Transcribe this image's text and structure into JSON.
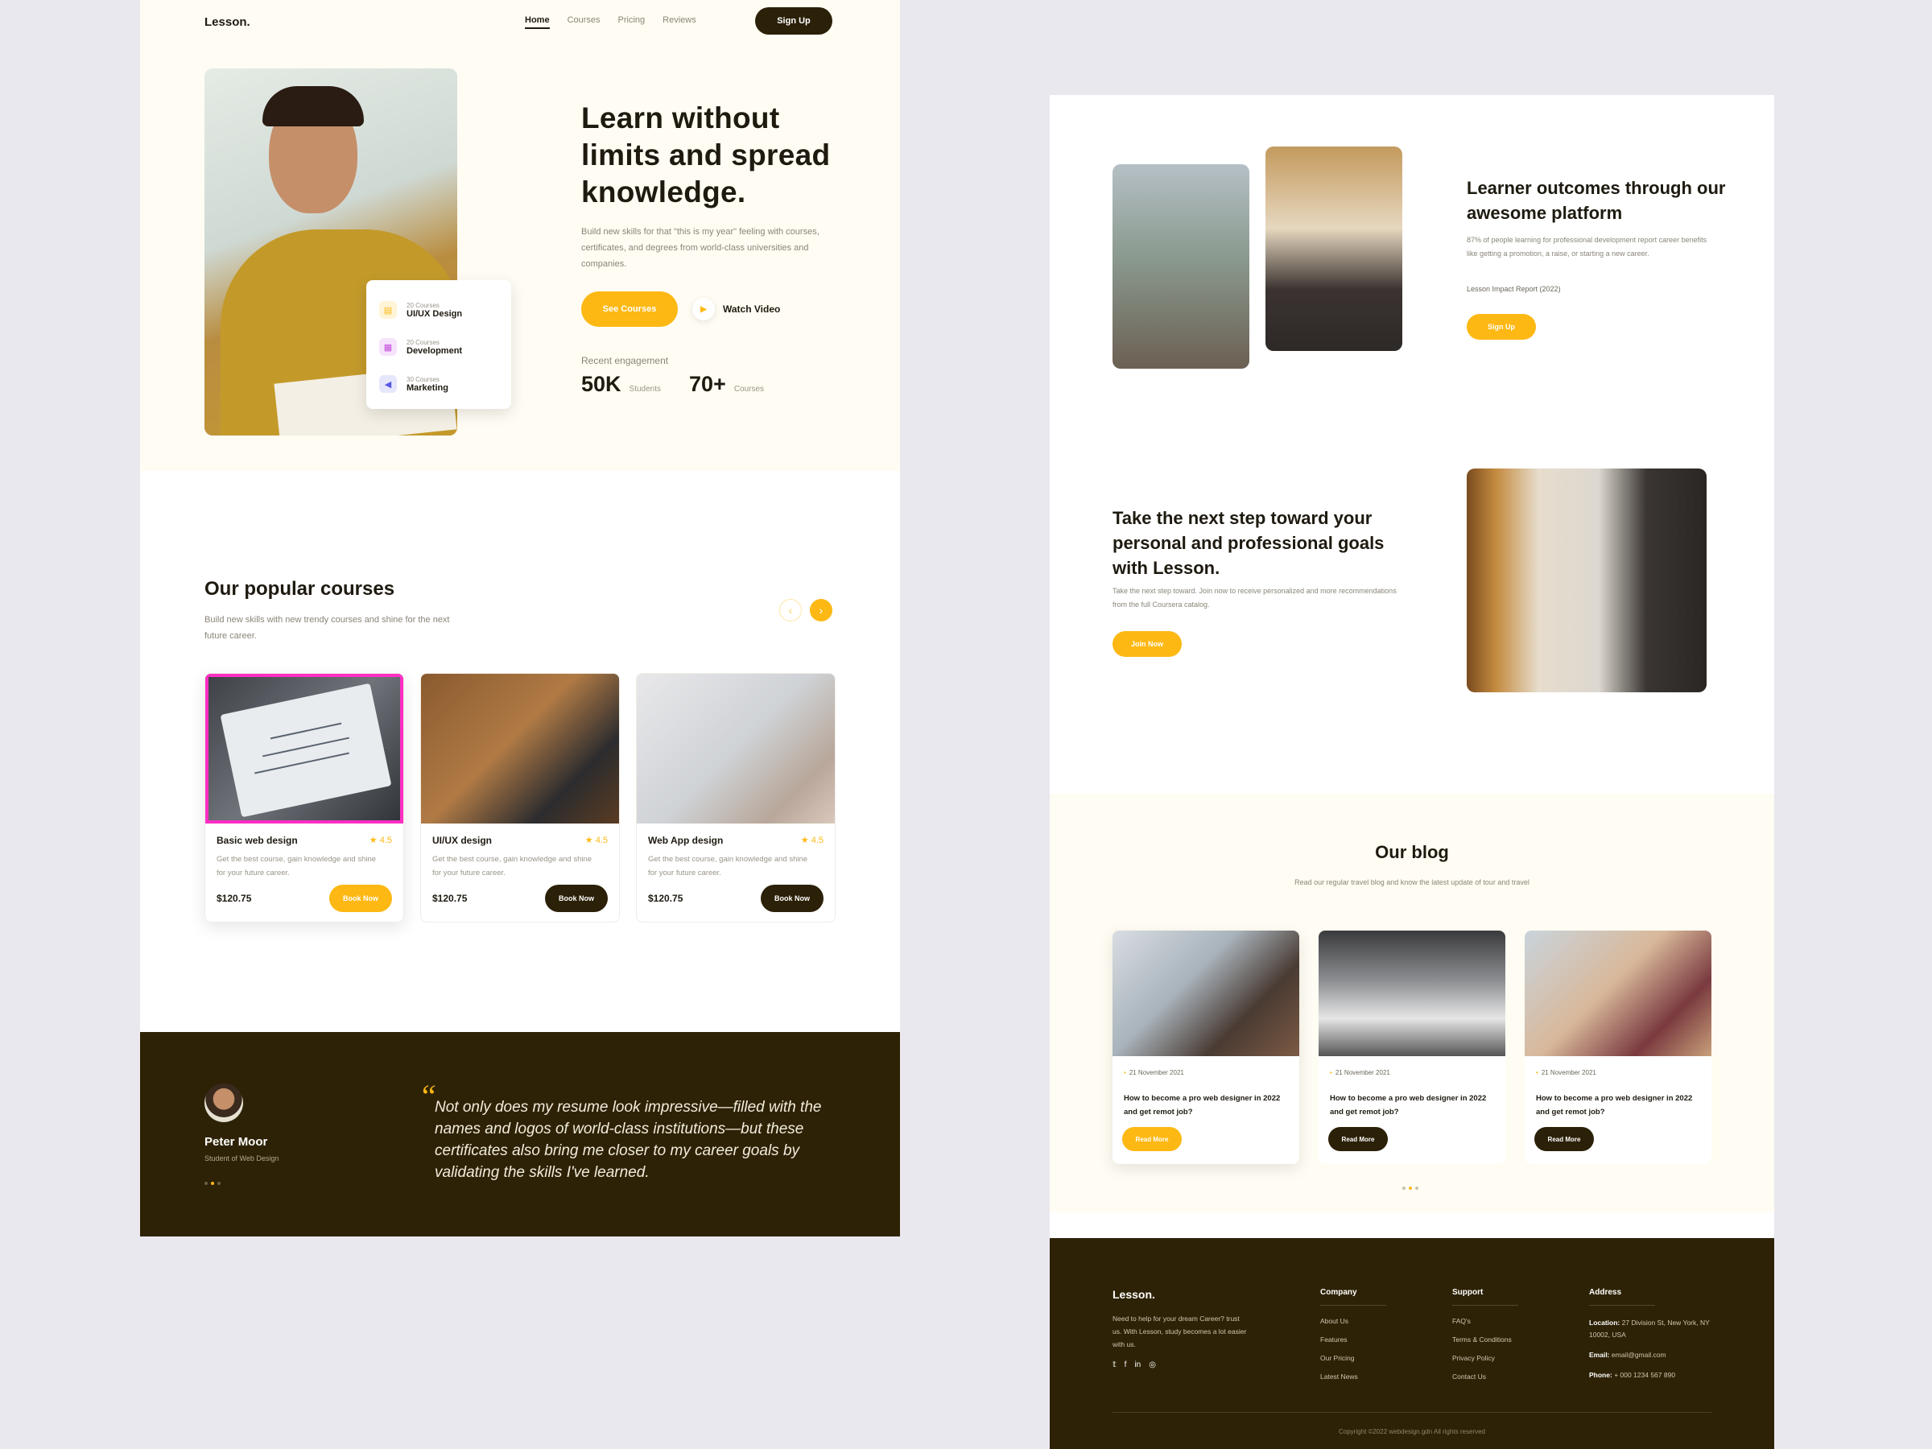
{
  "colors": {
    "accent": "#fdb813",
    "dark": "#2e2206",
    "highlight": "#ff2ec4",
    "cream": "#fffcf3"
  },
  "left": {
    "nav": {
      "logo": "Lesson.",
      "links": [
        "Home",
        "Courses",
        "Pricing",
        "Reviews"
      ],
      "active": "Home",
      "signup": "Sign Up"
    },
    "hero": {
      "title": "Learn without limits and spread knowledge.",
      "subtitle": "Build new skills for that \"this is my year\" feeling with courses, certificates, and degrees from world-class universities and companies.",
      "cta": "See Courses",
      "watch": "Watch Video",
      "engagement_label": "Recent engagement",
      "stats": [
        {
          "value": "50K",
          "label": "Students"
        },
        {
          "value": "70+",
          "label": "Courses"
        }
      ],
      "categories": [
        {
          "count": "20 Courses",
          "name": "UI/UX Design",
          "icon": "layout-icon",
          "color": "#fdb813",
          "bg": "#fff4d6"
        },
        {
          "count": "20 Courses",
          "name": "Development",
          "icon": "code-icon",
          "color": "#c24bd8",
          "bg": "#f6e3fb"
        },
        {
          "count": "30 Courses",
          "name": "Marketing",
          "icon": "megaphone-icon",
          "color": "#5a57e6",
          "bg": "#e6e6fc"
        }
      ]
    },
    "courses": {
      "title": "Our popular courses",
      "subtitle": "Build new skills with new trendy courses and shine for the next future career.",
      "items": [
        {
          "name": "Basic web design",
          "rating": "4.5",
          "desc": "Get the best course, gain knowledge and shine for your future career.",
          "price": "$120.75",
          "button": "Book Now"
        },
        {
          "name": "UI/UX design",
          "rating": "4.5",
          "desc": "Get the best course, gain knowledge and shine for your future career.",
          "price": "$120.75",
          "button": "Book Now"
        },
        {
          "name": "Web App design",
          "rating": "4.5",
          "desc": "Get the best course, gain knowledge and shine for your future career.",
          "price": "$120.75",
          "button": "Book Now"
        }
      ]
    },
    "testimonial": {
      "name": "Peter Moor",
      "role": "Student of Web Design",
      "quote_mark": "“",
      "quote": "Not only does my resume look impressive—filled with the names and logos of world-class institutions—but these certificates also bring me closer to my career goals by validating the skills I've learned."
    }
  },
  "right": {
    "outcomes": {
      "title": "Learner outcomes through our awesome platform",
      "text": "87% of people learning for professional development report career benefits like getting a promotion, a raise, or starting a new career.",
      "report": "Lesson Impact Report (2022)",
      "button": "Sign Up"
    },
    "nextstep": {
      "title": "Take the next step toward your personal and professional goals with Lesson.",
      "text": "Take the next step toward. Join now to receive personalized and more recommendations from the full Coursera catalog.",
      "button": "Join Now"
    },
    "blog": {
      "title": "Our blog",
      "subtitle": "Read our regular travel blog and know the latest update of tour and travel",
      "posts": [
        {
          "date": "21 November 2021",
          "title": "How to become a pro web designer in 2022 and get remot job?",
          "button": "Read More"
        },
        {
          "date": "21 November 2021",
          "title": "How to become a pro web designer in 2022 and get remot job?",
          "button": "Read More"
        },
        {
          "date": "21 November 2021",
          "title": "How to become a pro web designer in 2022 and get remot job?",
          "button": "Read More"
        }
      ]
    },
    "footer": {
      "logo": "Lesson.",
      "about": "Need to help for your dream Career? trust us. With Lesson, study becomes a lot easier with us.",
      "social": [
        "twitter-icon",
        "facebook-icon",
        "linkedin-icon",
        "instagram-icon"
      ],
      "company": {
        "title": "Company",
        "items": [
          "About Us",
          "Features",
          "Our Pricing",
          "Latest News"
        ]
      },
      "support": {
        "title": "Support",
        "items": [
          "FAQ's",
          "Terms & Conditions",
          "Privacy Policy",
          "Contact Us"
        ]
      },
      "address": {
        "title": "Address",
        "location_label": "Location:",
        "location": "27 Division St, New York, NY 10002, USA",
        "email_label": "Email:",
        "email": "email@gmail.com",
        "phone_label": "Phone:",
        "phone": "+ 000 1234 567 890"
      },
      "copyright": "Copyright ©2022 webdesign.gdn All rights reserved"
    }
  }
}
